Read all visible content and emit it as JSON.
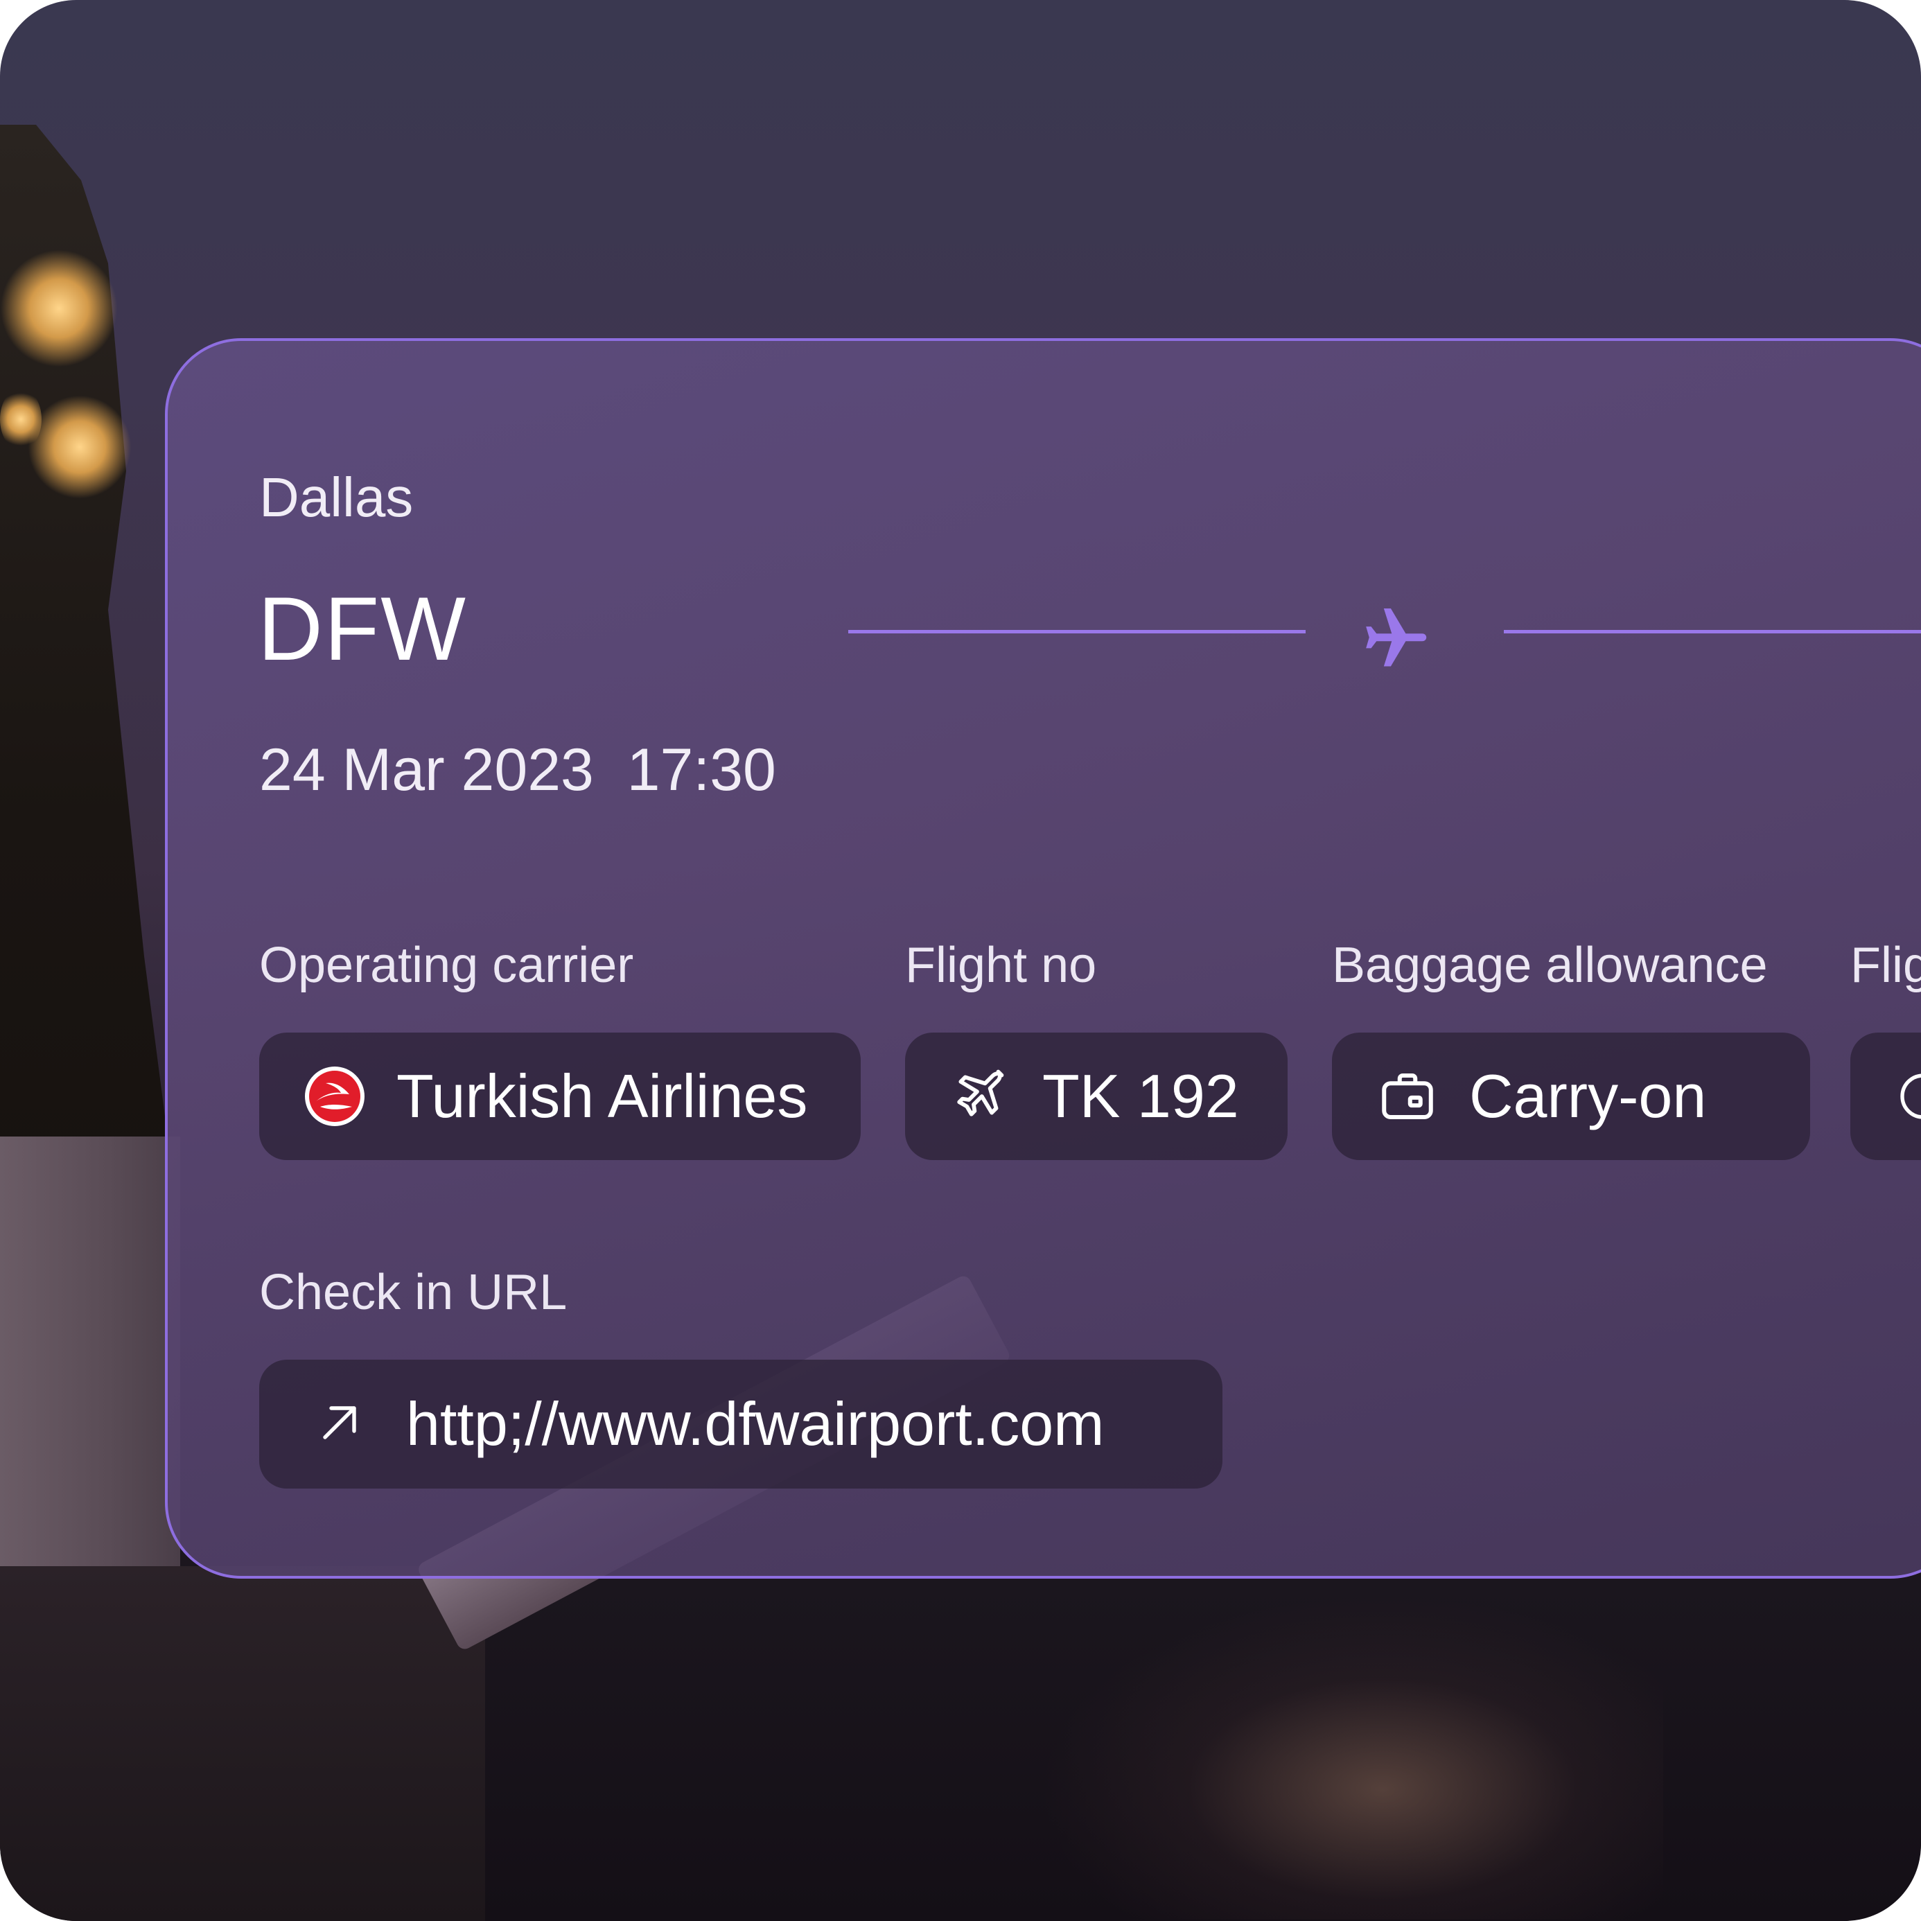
{
  "departure": {
    "city": "Dallas",
    "code": "DFW",
    "datetime": "24 Mar 2023  17:30"
  },
  "details": {
    "carrier_label": "Operating carrier",
    "carrier_value": "Turkish Airlines",
    "flight_label": "Flight no",
    "flight_value": "TK 192",
    "baggage_label": "Baggage allowance",
    "baggage_value": "Carry-on",
    "next_label_partial": "Flig"
  },
  "checkin": {
    "label": "Check in URL",
    "url": "http;//www.dfwairport.com"
  },
  "icons": {
    "route": "airplane-icon",
    "carrier": "turkish-airlines-logo",
    "flight": "airplane-outline-icon",
    "baggage": "briefcase-icon",
    "link": "arrow-up-right-icon"
  },
  "colors": {
    "accent": "#9a78ea",
    "card_border": "#8e6ee0",
    "pill_bg": "#2d2338",
    "airline_red": "#e11d2a"
  }
}
